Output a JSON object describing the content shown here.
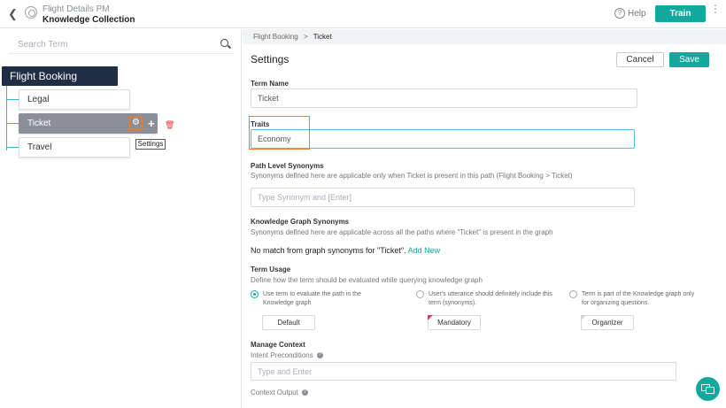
{
  "header": {
    "title": "Flight Details PM",
    "subtitle": "Knowledge Collection",
    "help_label": "Help",
    "train_label": "Train"
  },
  "sidebar": {
    "search_placeholder": "Search Term",
    "root": "Flight Booking",
    "nodes": [
      {
        "label": "Legal",
        "selected": false
      },
      {
        "label": "Ticket",
        "selected": true
      },
      {
        "label": "Travel",
        "selected": false
      }
    ],
    "tooltip": "Settings"
  },
  "breadcrumb": {
    "parent": "Flight Booking",
    "separator": ">",
    "current": "Ticket"
  },
  "settings": {
    "title": "Settings",
    "cancel_label": "Cancel",
    "save_label": "Save",
    "term_name": {
      "label": "Term Name",
      "value": "Ticket"
    },
    "traits": {
      "label": "Traits",
      "value": "Economy"
    },
    "path_synonyms": {
      "label": "Path Level Synonyms",
      "description": "Synonyms defined here are applicable only when Ticket is present in this path (Flight Booking > Ticket)",
      "placeholder": "Type Synonym and [Enter]"
    },
    "kg_synonyms": {
      "label": "Knowledge Graph Synonyms",
      "description": "Synonyms defined here are applicable across all the paths where \"Ticket\" is present in the graph",
      "no_match": "No match from graph synonyms for \"Ticket\".",
      "add_new": "Add New"
    },
    "term_usage": {
      "label": "Term Usage",
      "description": "Define how the term should be evaluated while querying knowledge graph",
      "options": [
        {
          "text": "Use term to evaluate the path in the Knowledge graph",
          "button": "Default",
          "checked": true
        },
        {
          "text": "User's utterance should definitely include this term (synonyms).",
          "button": "Mandatory",
          "checked": false
        },
        {
          "text": "Term is part of the Knowledge graph only for organizing questions.",
          "button": "Organizer",
          "checked": false
        }
      ]
    },
    "manage_context": {
      "label": "Manage Context",
      "intent_preconditions": "Intent Preconditions",
      "intent_placeholder": "Type and Enter",
      "context_output": "Context Output"
    }
  },
  "colors": {
    "accent": "#13a89e",
    "highlight": "#f07c2e",
    "root_node": "#1f2d45",
    "selected_node": "#8b9098"
  }
}
